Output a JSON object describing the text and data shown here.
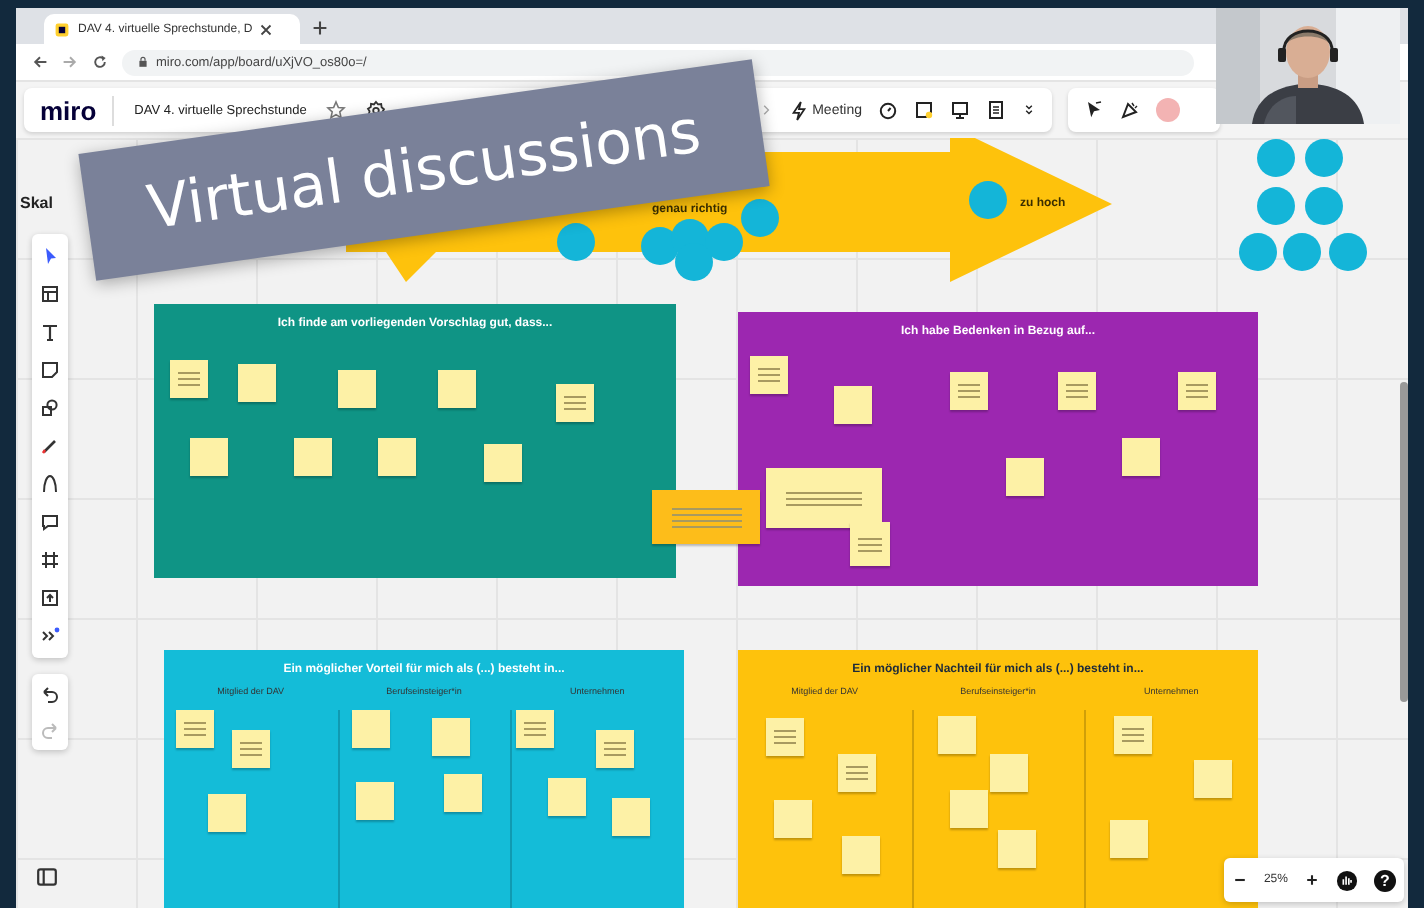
{
  "browser": {
    "tab_title": "DAV 4. virtuelle Sprechstunde, D",
    "url": "miro.com/app/board/uXjVO_os80o=/"
  },
  "app": {
    "logo": "miro",
    "board_title": "DAV 4. virtuelle Sprechstunde",
    "meeting_label": "Meeting"
  },
  "board": {
    "scale_label": "Skal",
    "arrow_labels": [
      "genau richtig",
      "zu hoch"
    ],
    "frames": [
      {
        "title": "Ich finde am vorliegenden Vorschlag gut, dass...",
        "color": "#0f9485"
      },
      {
        "title": "Ich habe Bedenken in Bezug auf...",
        "color": "#9c27b0"
      },
      {
        "title": "Ein möglicher Vorteil für mich als (...) besteht in...",
        "color": "#14bcd8",
        "columns": [
          "Mitglied der DAV",
          "Berufseinsteiger*in",
          "Unternehmen"
        ]
      },
      {
        "title": "Ein möglicher Nachteil für mich als (...) besteht in...",
        "color": "#fec20c",
        "columns": [
          "Mitglied der DAV",
          "Berufseinsteiger*in",
          "Unternehmen"
        ]
      }
    ]
  },
  "zoom": {
    "level_text": "25%",
    "help_glyph": "?"
  },
  "banner": {
    "text": "Virtual discussions"
  }
}
